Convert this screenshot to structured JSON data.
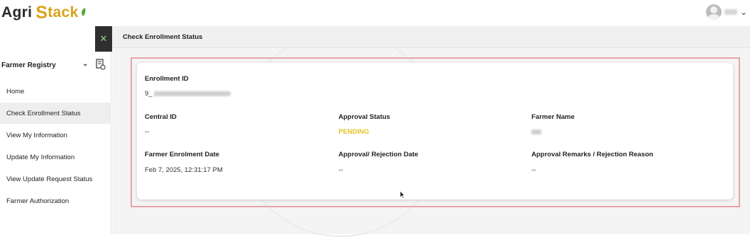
{
  "app": {
    "logo_text_agri": "Agri",
    "logo_text_s": "S",
    "logo_text_tack": "tack",
    "user_menu_icon": "chevron-down-icon"
  },
  "sidebar": {
    "close_icon": "close-icon",
    "section_title": "Farmer Registry",
    "items": [
      {
        "label": "Home",
        "active": false
      },
      {
        "label": "Check Enrollment Status",
        "active": true
      },
      {
        "label": "View My Information",
        "active": false
      },
      {
        "label": "Update My Information",
        "active": false
      },
      {
        "label": "View Update Request Status",
        "active": false
      },
      {
        "label": "Farmer Authorization",
        "active": false
      }
    ]
  },
  "main": {
    "title": "Check Enrollment Status",
    "fields": {
      "enrollment_id_label": "Enrollment ID",
      "enrollment_id_value_prefix": "9_",
      "central_id_label": "Central ID",
      "central_id_value": "--",
      "approval_status_label": "Approval Status",
      "approval_status_value": "PENDING",
      "farmer_name_label": "Farmer Name",
      "enrolment_date_label": "Farmer Enrolment Date",
      "enrolment_date_value": "Feb 7, 2025, 12:31:17 PM",
      "rejection_date_label": "Approval/ Rejection Date",
      "rejection_date_value": "--",
      "remarks_label": "Approval Remarks / Rejection Reason",
      "remarks_value": "--"
    }
  },
  "colors": {
    "pending": "#e6c22a",
    "highlight_border": "#e8a3a8",
    "close_button_bg": "#2f2f2f",
    "logo_accent": "#d9a21b"
  }
}
